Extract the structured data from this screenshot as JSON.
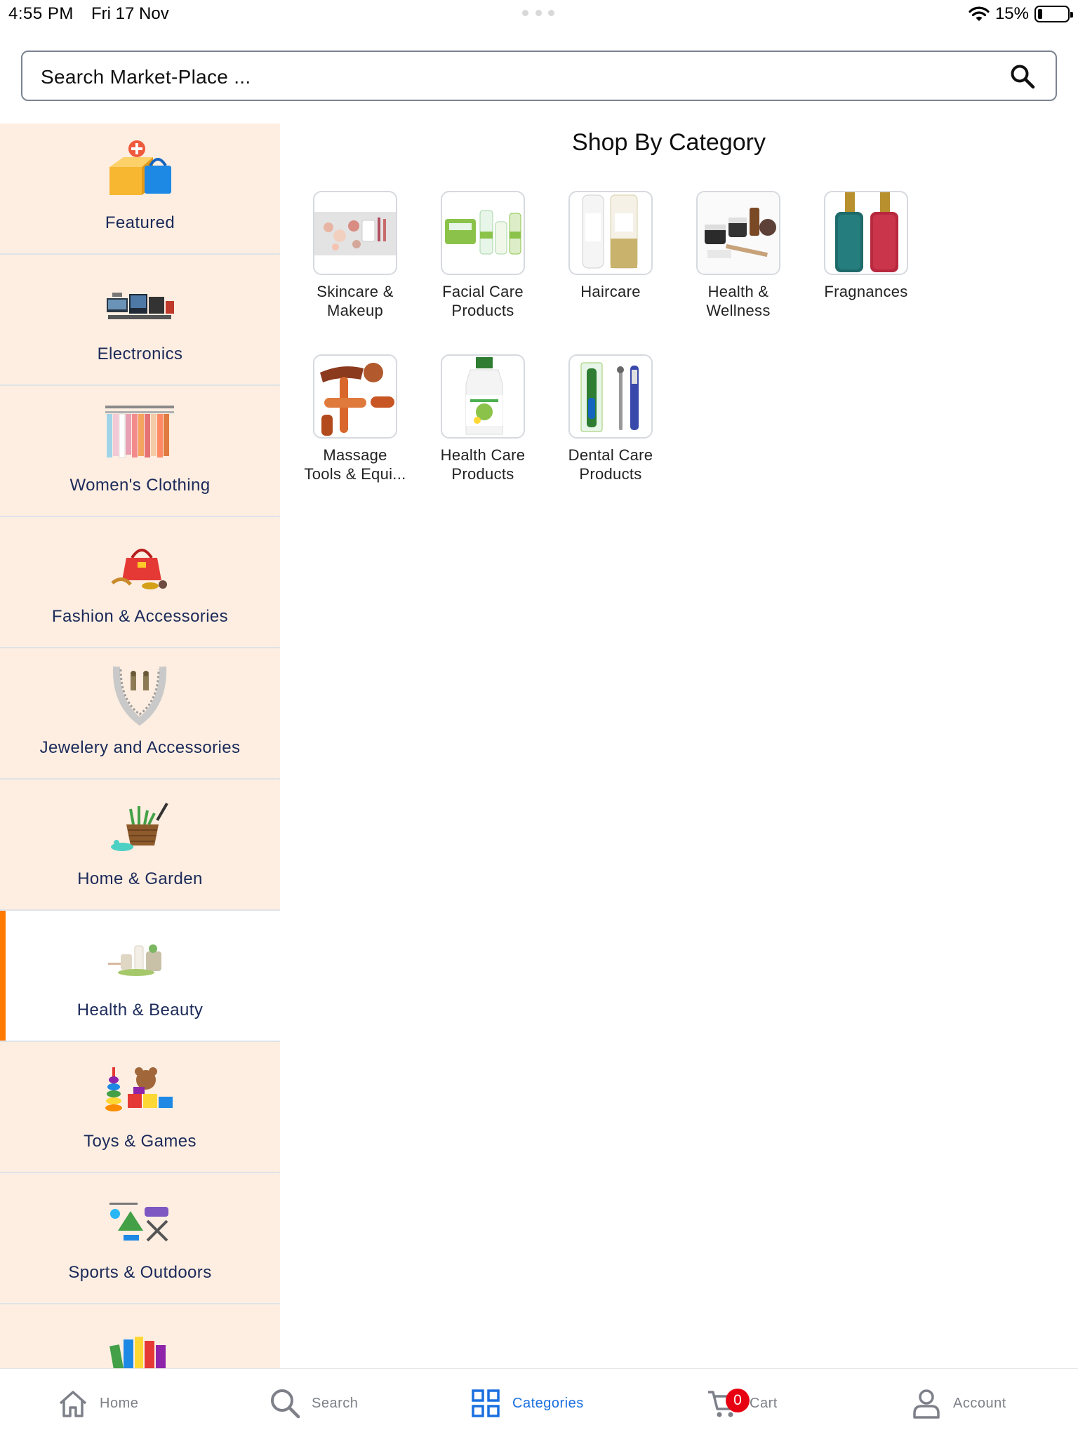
{
  "status_bar": {
    "time": "4:55 PM",
    "date": "Fri 17 Nov",
    "battery_percent": "15%",
    "battery_level": 0.15
  },
  "search": {
    "placeholder": "Search Market-Place ..."
  },
  "sidebar": {
    "items": [
      {
        "label": "Featured",
        "icon": "featured-box-icon",
        "active": false
      },
      {
        "label": "Electronics",
        "icon": "electronics-icon",
        "active": false
      },
      {
        "label": "Women's Clothing",
        "icon": "clothing-rack-icon",
        "active": false
      },
      {
        "label": "Fashion & Accessories",
        "icon": "handbag-icon",
        "active": false
      },
      {
        "label": "Jewelery and Accessories",
        "icon": "necklace-icon",
        "active": false
      },
      {
        "label": "Home & Garden",
        "icon": "garden-basket-icon",
        "active": false
      },
      {
        "label": "Health & Beauty",
        "icon": "beauty-products-icon",
        "active": true
      },
      {
        "label": "Toys & Games",
        "icon": "teddy-toys-icon",
        "active": false
      },
      {
        "label": "Sports & Outdoors",
        "icon": "sports-gear-icon",
        "active": false
      },
      {
        "label": "",
        "icon": "books-stationery-icon",
        "active": false
      }
    ]
  },
  "main": {
    "title": "Shop By Category",
    "categories": [
      {
        "label": "Skincare & Makeup",
        "line1": "Skincare &",
        "line2": "Makeup",
        "icon": "makeup-palette-icon"
      },
      {
        "label": "Facial Care Products",
        "line1": "Facial Care",
        "line2": "Products",
        "icon": "facial-wipes-icon"
      },
      {
        "label": "Haircare",
        "line1": "Haircare",
        "line2": "",
        "icon": "shampoo-bottles-icon"
      },
      {
        "label": "Health & Wellness",
        "line1": "Health &",
        "line2": "Wellness",
        "icon": "wellness-jars-icon"
      },
      {
        "label": "Fragnances",
        "line1": "Fragnances",
        "line2": "",
        "icon": "perfume-bottles-icon"
      },
      {
        "label": "Massage Tools & Equi...",
        "line1": "Massage",
        "line2": "Tools & Equi...",
        "icon": "wooden-massager-icon"
      },
      {
        "label": "Health Care Products",
        "line1": "Health Care",
        "line2": "Products",
        "icon": "juice-bottle-icon"
      },
      {
        "label": "Dental Care Products",
        "line1": "Dental Care",
        "line2": "Products",
        "icon": "toothbrush-icon"
      }
    ]
  },
  "bottom_nav": {
    "items": [
      {
        "label": "Home",
        "icon": "home-icon",
        "active": false
      },
      {
        "label": "Search",
        "icon": "search-icon",
        "active": false
      },
      {
        "label": "Categories",
        "icon": "grid-icon",
        "active": true
      },
      {
        "label": "Cart",
        "icon": "cart-icon",
        "active": false
      },
      {
        "label": "Account",
        "icon": "user-icon",
        "active": false
      }
    ],
    "cart_count": "0"
  },
  "colors": {
    "accent": "#ff7a00",
    "active_nav": "#1a6fe0",
    "sidebar_bg": "#fdeee1",
    "sidebar_text": "#1c2a5a",
    "badge": "#e60012"
  }
}
